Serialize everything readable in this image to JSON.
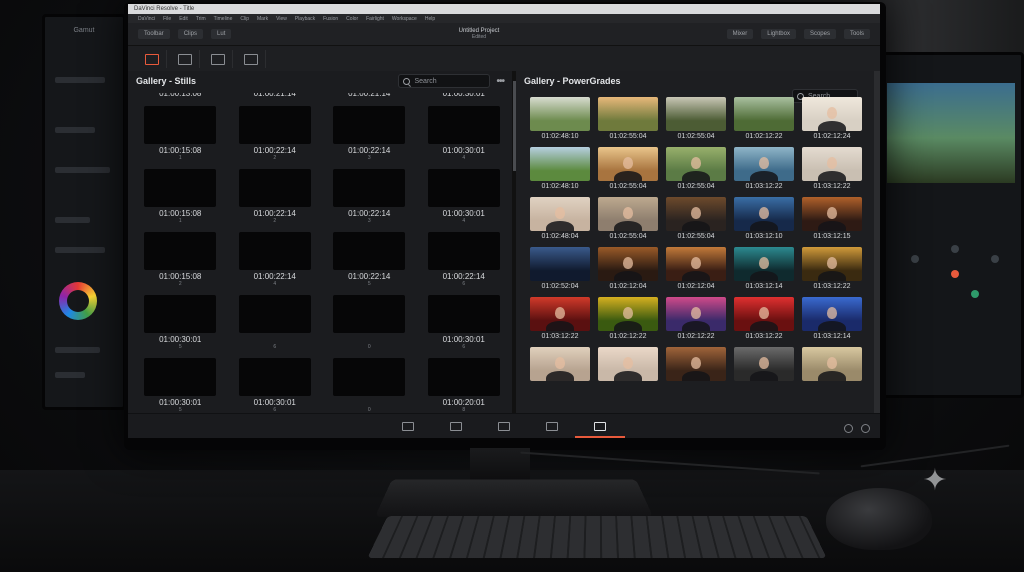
{
  "app": {
    "title": "DaVinci Resolve - Title",
    "menu": [
      "DaVinci",
      "File",
      "Edit",
      "Trim",
      "Timeline",
      "Clip",
      "Mark",
      "View",
      "Playback",
      "Fusion",
      "Color",
      "Fairlight",
      "Workspace",
      "Help"
    ],
    "toolbar_left": [
      "Toolbar",
      "Clips",
      "Lut"
    ],
    "project_title": "Untitled Project",
    "project_subtitle": "Edited",
    "toolbar_right": [
      "Mixer",
      "Lightbox",
      "Scopes",
      "Tools"
    ]
  },
  "stills_panel": {
    "title": "Gallery - Stills",
    "search_placeholder": "Search",
    "header_timecodes": [
      "01:00:13:08",
      "01:00:21:14",
      "01:00:21:14",
      "01:00:30:01"
    ],
    "rows": [
      [
        {
          "tc": "01:00:15:08",
          "n": "1"
        },
        {
          "tc": "01:00:22:14",
          "n": "2"
        },
        {
          "tc": "01:00:22:14",
          "n": "3"
        },
        {
          "tc": "01:00:30:01",
          "n": "4"
        }
      ],
      [
        {
          "tc": "01:00:15:08",
          "n": "1"
        },
        {
          "tc": "01:00:22:14",
          "n": "2"
        },
        {
          "tc": "01:00:22:14",
          "n": "3"
        },
        {
          "tc": "01:00:30:01",
          "n": "4"
        }
      ],
      [
        {
          "tc": "01:00:15:08",
          "n": "2"
        },
        {
          "tc": "01:00:22:14",
          "n": "4"
        },
        {
          "tc": "01:00:22:14",
          "n": "5"
        },
        {
          "tc": "01:00:22:14",
          "n": "6"
        }
      ],
      [
        {
          "tc": "01:00:30:01",
          "n": "5"
        },
        {
          "tc": "",
          "n": "6"
        },
        {
          "tc": "",
          "n": "0"
        },
        {
          "tc": "01:00:30:01",
          "n": "6"
        }
      ],
      [
        {
          "tc": "01:00:30:01",
          "n": "5"
        },
        {
          "tc": "01:00:30:01",
          "n": "6"
        },
        {
          "tc": "",
          "n": "0"
        },
        {
          "tc": "01:00:20:01",
          "n": "8"
        }
      ],
      [
        {
          "tc": "",
          "n": ""
        },
        {
          "tc": "",
          "n": ""
        },
        {
          "tc": "",
          "n": ""
        },
        {
          "tc": "",
          "n": ""
        }
      ]
    ]
  },
  "grades_panel": {
    "title": "Gallery - PowerGrades",
    "search_placeholder": "Search",
    "rows": [
      [
        {
          "tc": "01:02:48:10",
          "bg": "#6d8b4e",
          "sky": "#d8dcd0",
          "face": false
        },
        {
          "tc": "01:02:55:04",
          "bg": "#6f7a3c",
          "sky": "#e8b87a",
          "face": false
        },
        {
          "tc": "01:02:55:04",
          "bg": "#4c5c34",
          "sky": "#c9c7b6",
          "face": false
        },
        {
          "tc": "01:02:12:22",
          "bg": "#4e6b35",
          "sky": "#a9c0a0",
          "face": false
        },
        {
          "tc": "01:02:12:24",
          "bg": "#d8d0c4",
          "sky": "#efe8dc",
          "face": true
        }
      ],
      [
        {
          "tc": "01:02:48:10",
          "bg": "#5c8a3e",
          "sky": "#b6cfe0",
          "face": false
        },
        {
          "tc": "01:02:55:04",
          "bg": "#a8743f",
          "sky": "#e9c58b",
          "face": true
        },
        {
          "tc": "01:02:55:04",
          "bg": "#5b7b45",
          "sky": "#98b06c",
          "face": true
        },
        {
          "tc": "01:03:12:22",
          "bg": "#3e6b8a",
          "sky": "#8fb5c8",
          "face": true
        },
        {
          "tc": "01:03:12:22",
          "bg": "#c9bfb2",
          "sky": "#e4dbd0",
          "face": true
        }
      ],
      [
        {
          "tc": "01:02:48:04",
          "bg": "#c7b3a0",
          "sky": "#e0d2c2",
          "face": true
        },
        {
          "tc": "01:02:55:04",
          "bg": "#8e7e6e",
          "sky": "#bda98f",
          "face": true
        },
        {
          "tc": "01:02:55:04",
          "bg": "#2a2320",
          "sky": "#6d4a2c",
          "face": true
        },
        {
          "tc": "01:03:12:10",
          "bg": "#16294a",
          "sky": "#3a6ea6",
          "face": true
        },
        {
          "tc": "01:03:12:15",
          "bg": "#2e1a14",
          "sky": "#b0602a",
          "face": true
        }
      ],
      [
        {
          "tc": "01:02:52:04",
          "bg": "#101a2e",
          "sky": "#3a5a8c",
          "face": false
        },
        {
          "tc": "01:02:12:04",
          "bg": "#2a1a12",
          "sky": "#9a5a28",
          "face": true
        },
        {
          "tc": "01:02:12:04",
          "bg": "#3a1e14",
          "sky": "#c27a3a",
          "face": true
        },
        {
          "tc": "01:03:12:14",
          "bg": "#0f2a2e",
          "sky": "#2c8a90",
          "face": true
        },
        {
          "tc": "01:03:12:22",
          "bg": "#3a2a10",
          "sky": "#d09a3a",
          "face": true
        }
      ],
      [
        {
          "tc": "01:03:12:22",
          "bg": "#5a1010",
          "sky": "#d23a2a",
          "face": true
        },
        {
          "tc": "01:02:12:22",
          "bg": "#3a5a10",
          "sky": "#d6b020",
          "face": true
        },
        {
          "tc": "01:02:12:22",
          "bg": "#3a2a6a",
          "sky": "#d04a8a",
          "face": true
        },
        {
          "tc": "01:03:12:22",
          "bg": "#6a1010",
          "sky": "#e03030",
          "face": true
        },
        {
          "tc": "01:03:12:14",
          "bg": "#1a2a6a",
          "sky": "#3a6ad0",
          "face": true
        }
      ],
      [
        {
          "tc": "",
          "bg": "#b7a390",
          "sky": "#e0d0bc",
          "face": true
        },
        {
          "tc": "",
          "bg": "#c9b8a8",
          "sky": "#ead8c8",
          "face": true
        },
        {
          "tc": "",
          "bg": "#3a2418",
          "sky": "#a0643a",
          "face": true
        },
        {
          "tc": "",
          "bg": "#2a2a2a",
          "sky": "#6a6a6a",
          "face": true
        },
        {
          "tc": "",
          "bg": "#9a8a6a",
          "sky": "#d8c8a0",
          "face": true
        }
      ]
    ]
  },
  "pages": [
    "media",
    "cut",
    "edit",
    "fusion",
    "color"
  ],
  "active_page": "color",
  "colors": {
    "accent": "#e85a3c",
    "panel": "#1b1c1f",
    "text": "#d7d9dc"
  }
}
